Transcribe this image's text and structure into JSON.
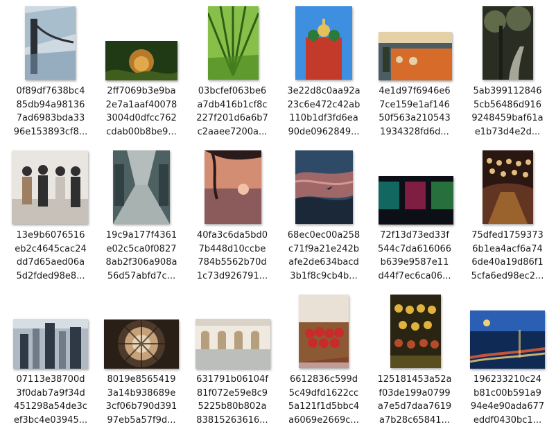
{
  "files": [
    {
      "name": "0f89df7638bc4\n85db94a98136\n7ad6983bda33\n96e153893cf8...",
      "subject": "bridge photo",
      "palette": [
        "#6f8fa8",
        "#cfd9e2",
        "#2b2f35",
        "#9fb6c8"
      ]
    },
    {
      "name": "2ff7069b3e9ba\n2e7a1aaf40078\n3004d0dfcc762\ncdab00b8be9...",
      "subject": "lion photo",
      "palette": [
        "#1f3a14",
        "#b67a2a",
        "#3f5d1c",
        "#e0a94c"
      ]
    },
    {
      "name": "03bcfef063be6\na7db416b1cf8c\n227f201d6a6b7\nc2aaee7200a...",
      "subject": "palm leaf photo",
      "palette": [
        "#4d8a22",
        "#88bf49",
        "#2f5f17",
        "#b9dc7a"
      ]
    },
    {
      "name": "3e22d8c0aa92a\n23c6e472c42ab\n110b1df3fd6ea\n90de0962849...",
      "subject": "cathedral photo",
      "palette": [
        "#3f8fe0",
        "#c33a2a",
        "#2a7a3a",
        "#e6c15a"
      ]
    },
    {
      "name": "4e1d97f6946e6\n7ce159e1af146\n50f563a210543\n1934328fd6d...",
      "subject": "market stall photo",
      "palette": [
        "#4b5c63",
        "#d76b2a",
        "#e4d1a8",
        "#2f3b2a"
      ]
    },
    {
      "name": "5ab399112846\n5cb56486d916\n9248459baf61a\ne1b73d4e2d...",
      "subject": "forest path photo",
      "palette": [
        "#2a2e22",
        "#6f7a55",
        "#cfcfc0",
        "#1a1d16"
      ]
    },
    {
      "name": "13e9b6076516\neb2c4645cac24\ndd7d65aed06a\n5d2fded98e8...",
      "subject": "group photo",
      "palette": [
        "#e9e6e1",
        "#c7c1ba",
        "#2f2f2f",
        "#9e7f62"
      ]
    },
    {
      "name": "19c9a177f4361\ne02c5ca0f0827\n8ab2f306a908a\n56d57abfd7c...",
      "subject": "gallery hall photo",
      "palette": [
        "#2b3a3c",
        "#a8b2b1",
        "#4e6162",
        "#dfe3e2"
      ]
    },
    {
      "name": "40fa3c6da5bd0\n7b448d10ccbe\n784b5562b70d\n1c73d926791...",
      "subject": "palm sunset photo",
      "palette": [
        "#d38d73",
        "#f2c2a8",
        "#2b1a1a",
        "#8b5a5a"
      ]
    },
    {
      "name": "68ec0ec00a258\nc71f9a21e242b\nafe2de634bacd\n3b1f8c9cb4b...",
      "subject": "sky clouds photo",
      "palette": [
        "#2f4a66",
        "#b46c6a",
        "#e7a7a0",
        "#1b2838"
      ]
    },
    {
      "name": "72f13d73ed33f\n544c7da616066\nb639e9587e11\nd44f7ec6ca06...",
      "subject": "neon room photo",
      "palette": [
        "#0c0f16",
        "#17b0a0",
        "#e02a6a",
        "#40c060"
      ]
    },
    {
      "name": "75dfed1759373\n6b1ea4acf6a74\n6de40a19d86f1\n5cfa6ed98ec2...",
      "subject": "street lanterns photo",
      "palette": [
        "#2a1712",
        "#e19a3c",
        "#6b3b24",
        "#f6d08a"
      ]
    },
    {
      "name": "07113e38700d\n3f0dab7a9f34d\n451298a54de3c\nef3bc4e03945...",
      "subject": "city aerial photo",
      "palette": [
        "#6f7c88",
        "#aeb9c3",
        "#2f3945",
        "#d6dde3"
      ]
    },
    {
      "name": "8019e8565419\n3a14b938689e\n3cf06b790d391\n97eb5a57f9d...",
      "subject": "dome ceiling photo",
      "palette": [
        "#4d3a2a",
        "#c6a27b",
        "#2a1f17",
        "#e7d3b6"
      ]
    },
    {
      "name": "631791b06104f\n81f072e59e8c9\n5225b80b802a\n83815263616...",
      "subject": "museum hall photo",
      "palette": [
        "#d9d2c7",
        "#b69f7d",
        "#7c8a90",
        "#efe9df"
      ]
    },
    {
      "name": "6612836c599d\n5c49dfd1622cc\n5a121f1d5bbc4\na6069e2669c...",
      "subject": "apples crate photo",
      "palette": [
        "#c92b2b",
        "#8b5a34",
        "#e9e1d6",
        "#6f1a1a"
      ]
    },
    {
      "name": "125181453a52a\nf03de199a0799\na7e5d7daa7619\na7b28c65841...",
      "subject": "fruit display photo",
      "palette": [
        "#2a2412",
        "#e0b33c",
        "#7a6a2a",
        "#b54b2a"
      ]
    },
    {
      "name": "196233210c24\nb81c00b591a9\n94e4e90ada677\neddf0430bc1...",
      "subject": "night street photo",
      "palette": [
        "#0f2a55",
        "#2a5fb4",
        "#d85a3a",
        "#f1d27a"
      ]
    }
  ]
}
